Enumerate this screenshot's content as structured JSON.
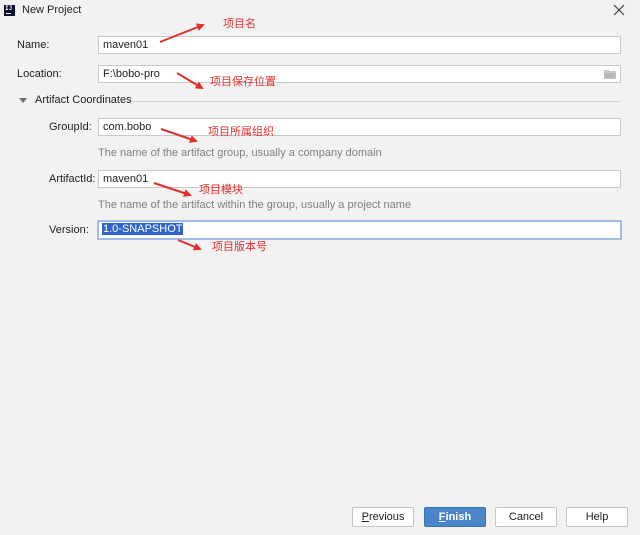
{
  "window": {
    "title": "New Project",
    "app_icon_text": "IJ"
  },
  "form": {
    "name": {
      "label": "Name:",
      "value": "maven01"
    },
    "location": {
      "label": "Location:",
      "value": "F:\\bobo-pro"
    },
    "section_title": "Artifact Coordinates",
    "group_id": {
      "label": "GroupId:",
      "value": "com.bobo",
      "hint": "The name of the artifact group, usually a company domain"
    },
    "artifact_id": {
      "label": "ArtifactId:",
      "value": "maven01",
      "hint": "The name of the artifact within the group, usually a project name"
    },
    "version": {
      "label": "Version:",
      "value": "1.0-SNAPSHOT"
    }
  },
  "annotations": {
    "name": "项目名",
    "location": "项目保存位置",
    "group_id": "项目所属组织",
    "artifact_id": "项目模块",
    "version": "项目版本号"
  },
  "buttons": {
    "previous": {
      "mnemonic": "P",
      "rest": "revious"
    },
    "finish": {
      "mnemonic": "F",
      "rest": "inish"
    },
    "cancel": "Cancel",
    "help": "Help"
  },
  "colors": {
    "annotation": "#e0302d",
    "primary_button": "#4a86c7",
    "selection": "#2f65ca",
    "focus_border": "#9fbde6"
  }
}
